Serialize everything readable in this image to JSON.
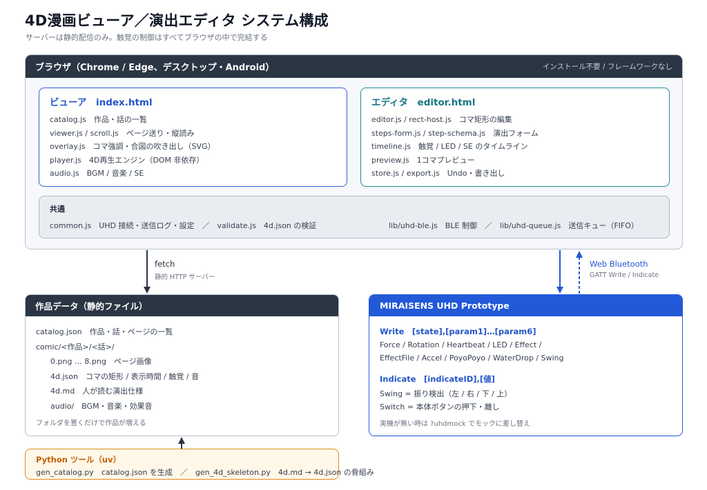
{
  "title": "4D漫画ビューア／演出エディタ システム構成",
  "subtitle": "サーバーは静的配信のみ。触覚の制御はすべてブラウザの中で完結する",
  "browser": {
    "title": "ブラウザ（Chrome / Edge、デスクトップ・Android）",
    "note": "インストール不要 / フレームワークなし",
    "viewer": {
      "title": "ビューア　index.html",
      "items": [
        "catalog.js　作品・話の一覧",
        "viewer.js / scroll.js　ページ送り・縦読み",
        "overlay.js　コマ強調・合図の吹き出し（SVG）",
        "player.js　4D再生エンジン（DOM 非依存）",
        "audio.js　BGM / 音楽 / SE"
      ]
    },
    "editor": {
      "title": "エディタ　editor.html",
      "items": [
        "editor.js / rect-host.js　コマ矩形の編集",
        "steps-form.js / step-schema.js　演出フォーム",
        "timeline.js　触覚 / LED / SE のタイムライン",
        "preview.js　1コマプレビュー",
        "store.js / export.js　Undo・書き出し"
      ]
    },
    "common": {
      "title": "共通",
      "left": "common.js　UHD 接続・送信ログ・設定　／　validate.js　4d.json の検証",
      "right": "lib/uhd-ble.js　BLE 制御　／　lib/uhd-queue.js　送信キュー（FIFO）"
    }
  },
  "edges": {
    "fetch": "fetch",
    "fetch_sub": "静的 HTTP サーバー",
    "web_bluetooth": "Web Bluetooth",
    "web_bluetooth_sub": "GATT Write / Indicate"
  },
  "works": {
    "title": "作品データ（静的ファイル）",
    "items": [
      "catalog.json　作品・話・ページの一覧",
      "comic/<作品>/<話>/",
      "0.png … 8.png　ページ画像",
      "4d.json　コマの矩形 / 表示時間 / 触覚 / 音",
      "4d.md　人が読む演出仕様",
      "audio/　BGM・音楽・効果音"
    ],
    "note": "フォルダを置くだけで作品が増える"
  },
  "uhd": {
    "title": "MIRAISENS UHD Prototype",
    "write_title": "Write　[state],[param1]…[param6]",
    "write_line1": "Force / Rotation / Heartbeat / LED / Effect /",
    "write_line2": "EffectFile / Accel / PoyoPoyo / WaterDrop / Swing",
    "indicate_title": "Indicate　[indicateID],[値]",
    "indicate_line1": "Swing = 振り検出（左 / 右 / 下 / 上）",
    "indicate_line2": "Switch = 本体ボタンの押下・離し",
    "note": "実機が無い時は ?uhdmock でモックに差し替え"
  },
  "python": {
    "title": "Python ツール（uv）",
    "desc": "gen_catalog.py　catalog.json を生成　／　gen_4d_skeleton.py　4d.md → 4d.json の骨組み"
  },
  "colors": {
    "dark_header": "#2b3644",
    "viewer_accent": "#2f62d6",
    "editor_accent": "#1f8a9a",
    "uhd_accent": "#2259d8",
    "python_accent": "#e08a1e"
  }
}
